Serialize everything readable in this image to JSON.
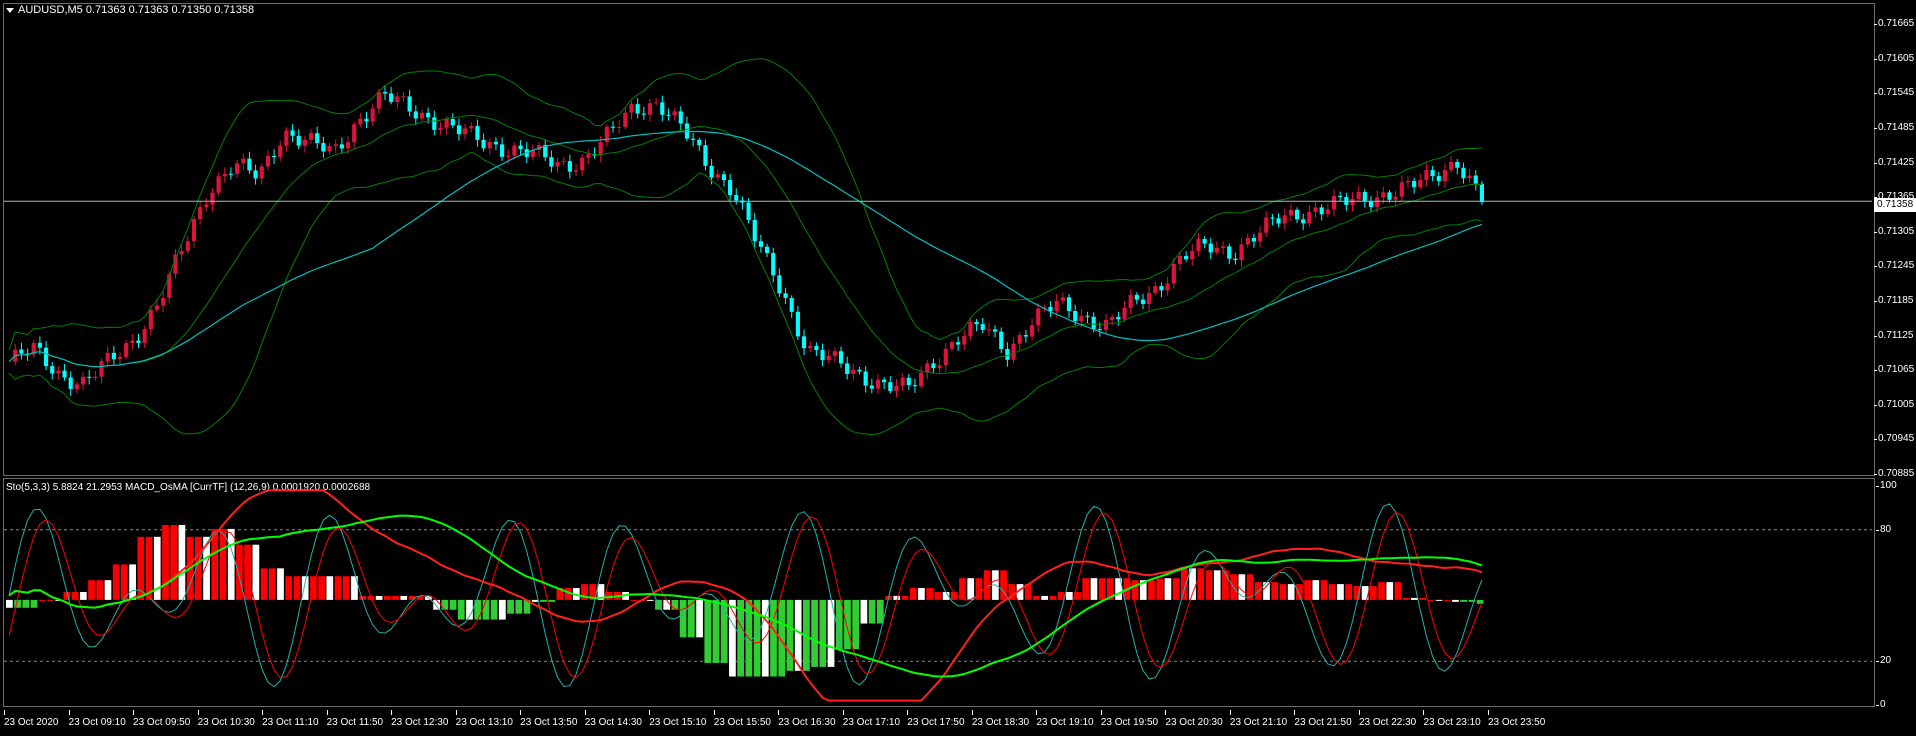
{
  "main_chart": {
    "symbol_line": "AUDUSD,M5  0.71363 0.71363 0.71350 0.71358",
    "current_price": "0.71358",
    "price_ticks": [
      "0.71665",
      "0.71605",
      "0.71545",
      "0.71485",
      "0.71425",
      "0.71365",
      "0.71305",
      "0.71245",
      "0.71185",
      "0.71125",
      "0.71065",
      "0.71005",
      "0.70945",
      "0.70885"
    ],
    "colors": {
      "bull": "#dc143c",
      "bear": "#00ffff",
      "bands": "#008000",
      "ma": "#00c0c0",
      "level_line": "#a0c0c0"
    }
  },
  "sub_chart": {
    "title": "Sto(5,3,3) 5.8824 21.2953  MACD_OsMA [CurrTF] (12,26,9) 0.0001920 0.0002688",
    "levels": [
      "100",
      "80",
      "20",
      "0"
    ],
    "colors": {
      "stoch_main": "#20b2aa",
      "stoch_signal": "#ff0000",
      "macd": "#ff2020",
      "signal": "#00ff00",
      "hist_up": "#ff0000",
      "hist_dn": "#32cd32",
      "hist_neutral": "#ffffff"
    }
  },
  "time_axis": [
    "23 Oct 2020",
    "23 Oct 09:10",
    "23 Oct 09:50",
    "23 Oct 10:30",
    "23 Oct 11:10",
    "23 Oct 11:50",
    "23 Oct 12:30",
    "23 Oct 13:10",
    "23 Oct 13:50",
    "23 Oct 14:30",
    "23 Oct 15:10",
    "23 Oct 15:50",
    "23 Oct 16:30",
    "23 Oct 17:10",
    "23 Oct 17:50",
    "23 Oct 18:30",
    "23 Oct 19:10",
    "23 Oct 19:50",
    "23 Oct 20:30",
    "23 Oct 21:10",
    "23 Oct 21:50",
    "23 Oct 22:30",
    "23 Oct 23:10",
    "23 Oct 23:50"
  ],
  "chart_data": {
    "type": "candlestick",
    "symbol": "AUDUSD",
    "timeframe": "M5",
    "ohlc_last": {
      "open": 0.71363,
      "high": 0.71363,
      "low": 0.7135,
      "close": 0.71358
    },
    "close_series": [
      0.7108,
      0.711,
      0.7106,
      0.7104,
      0.7108,
      0.7112,
      0.7118,
      0.7128,
      0.7138,
      0.7142,
      0.714,
      0.7148,
      0.7146,
      0.7144,
      0.715,
      0.7154,
      0.7152,
      0.715,
      0.7148,
      0.7146,
      0.7145,
      0.7144,
      0.7142,
      0.7143,
      0.7147,
      0.7152,
      0.7153,
      0.7148,
      0.7142,
      0.7138,
      0.7128,
      0.712,
      0.711,
      0.7108,
      0.7106,
      0.7104,
      0.7103,
      0.7108,
      0.7112,
      0.7114,
      0.711,
      0.7115,
      0.7118,
      0.7116,
      0.7114,
      0.7118,
      0.7121,
      0.7126,
      0.7128,
      0.7127,
      0.713,
      0.7133,
      0.7134,
      0.7135,
      0.7136,
      0.7137,
      0.7138,
      0.714,
      0.7143,
      0.7136
    ],
    "ylim": [
      0.70885,
      0.717
    ],
    "sub_ylim": [
      0,
      100
    ],
    "sub_levels": [
      20,
      80
    ]
  }
}
